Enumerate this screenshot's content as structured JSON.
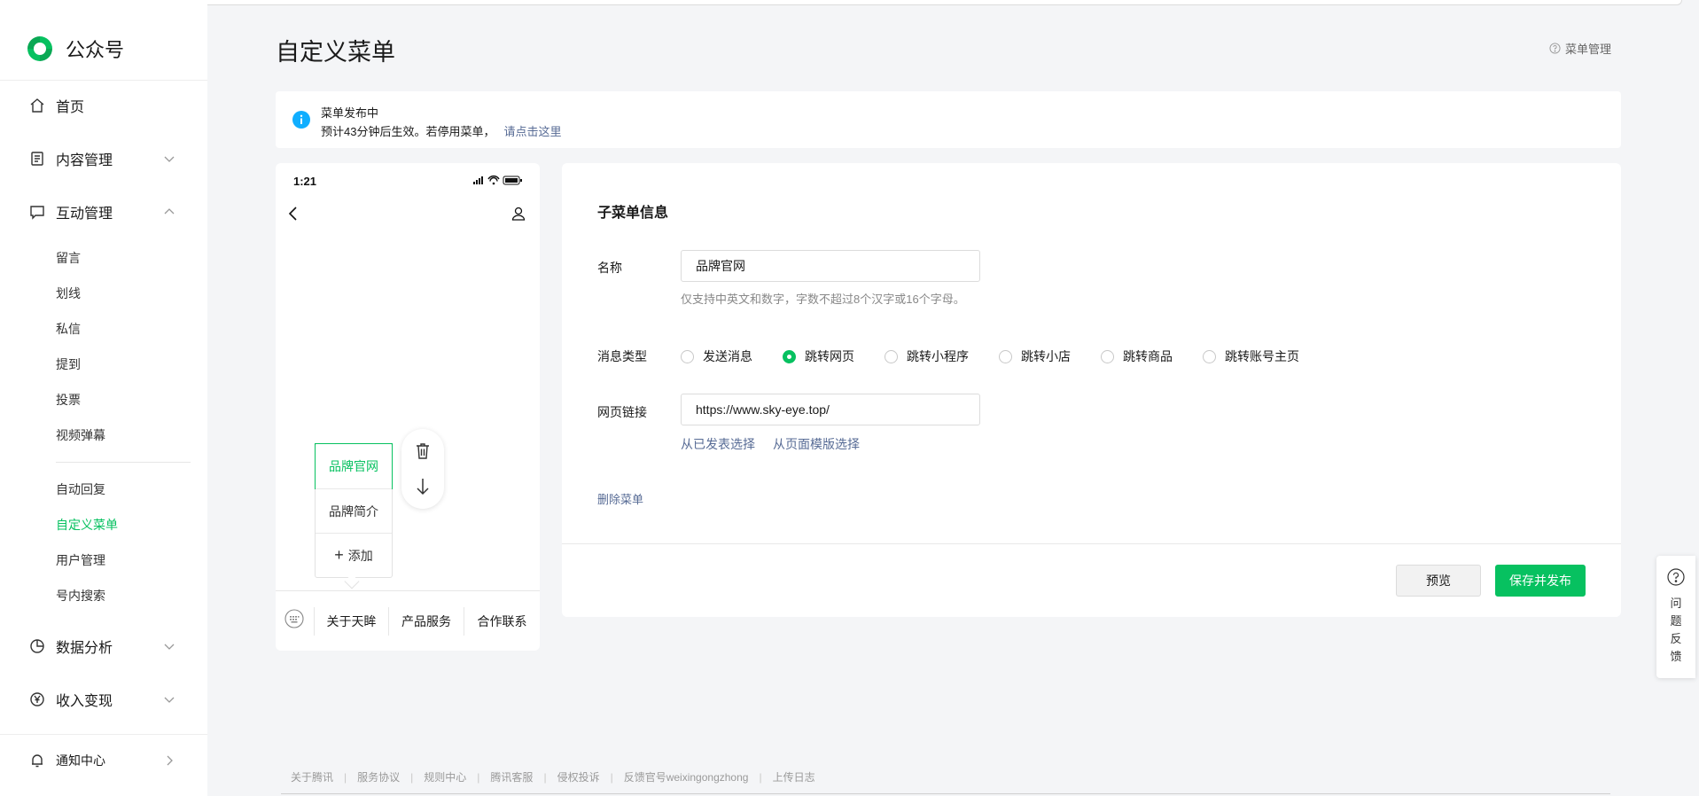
{
  "brand": {
    "name": "公众号"
  },
  "sidebar": {
    "main": [
      {
        "label": "首页"
      },
      {
        "label": "内容管理"
      },
      {
        "label": "互动管理"
      },
      {
        "label": "数据分析"
      },
      {
        "label": "收入变现"
      },
      {
        "label": "通知中心"
      }
    ],
    "interaction_sub": [
      "留言",
      "划线",
      "私信",
      "提到",
      "投票",
      "视频弹幕"
    ],
    "interaction_sub2": [
      "自动回复",
      "自定义菜单",
      "用户管理",
      "号内搜索"
    ],
    "active_item": "自定义菜单"
  },
  "header": {
    "title": "自定义菜单",
    "help_label": "菜单管理"
  },
  "notice": {
    "line1": "菜单发布中",
    "line2": "预计43分钟后生效。若停用菜单，",
    "link": "请点击这里"
  },
  "phone": {
    "time": "1:21",
    "submenu": [
      {
        "label": "品牌官网",
        "selected": true
      },
      {
        "label": "品牌简介",
        "selected": false
      }
    ],
    "add_label": "添加",
    "menubar": [
      "关于天眸",
      "产品服务",
      "合作联系"
    ]
  },
  "form": {
    "section_title": "子菜单信息",
    "name_label": "名称",
    "name_value": "品牌官网",
    "name_hint": "仅支持中英文和数字，字数不超过8个汉字或16个字母。",
    "type_label": "消息类型",
    "type_options": [
      "发送消息",
      "跳转网页",
      "跳转小程序",
      "跳转小店",
      "跳转商品",
      "跳转账号主页"
    ],
    "type_selected": "跳转网页",
    "url_label": "网页链接",
    "url_value": "https://www.sky-eye.top/",
    "link_published": "从已发表选择",
    "link_template": "从页面模版选择",
    "delete_label": "删除菜单",
    "preview_label": "预览",
    "save_label": "保存并发布"
  },
  "feedback": {
    "chars": [
      "问",
      "题",
      "反",
      "馈"
    ]
  },
  "footer": {
    "links": [
      "关于腾讯",
      "服务协议",
      "规则中心",
      "腾讯客服",
      "侵权投诉",
      "反馈官号weixingongzhong",
      "上传日志"
    ],
    "separator": "|"
  },
  "colors": {
    "accent": "#07c160",
    "link": "#576b95",
    "info": "#10aeff"
  }
}
